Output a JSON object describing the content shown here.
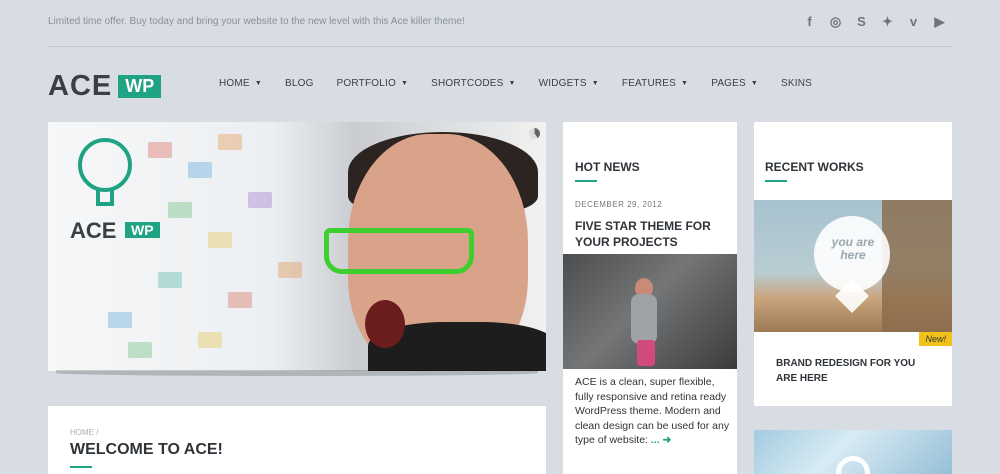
{
  "topbar": {
    "offer": "Limited time offer. Buy today and bring your website to the new level with this Ace killer theme!",
    "social": [
      {
        "icon": "facebook-icon",
        "glyph": "f"
      },
      {
        "icon": "dribbble-icon",
        "glyph": "◎"
      },
      {
        "icon": "skype-icon",
        "glyph": "S"
      },
      {
        "icon": "twitter-icon",
        "glyph": "✦"
      },
      {
        "icon": "vimeo-icon",
        "glyph": "v"
      },
      {
        "icon": "youtube-icon",
        "glyph": "▶"
      }
    ]
  },
  "logo": {
    "ace": "ACE",
    "wp": "WP"
  },
  "nav": {
    "items": [
      {
        "label": "HOME",
        "dropdown": true
      },
      {
        "label": "BLOG",
        "dropdown": false
      },
      {
        "label": "PORTFOLIO",
        "dropdown": true
      },
      {
        "label": "SHORTCODES",
        "dropdown": true
      },
      {
        "label": "WIDGETS",
        "dropdown": true
      },
      {
        "label": "FEATURES",
        "dropdown": true
      },
      {
        "label": "PAGES",
        "dropdown": true
      },
      {
        "label": "SKINS",
        "dropdown": false
      }
    ]
  },
  "hero": {
    "logo_ace": "ACE",
    "logo_wp": "WP"
  },
  "welcome": {
    "breadcrumb": "HOME /",
    "title": "WELCOME TO ACE!"
  },
  "news": {
    "title": "HOT NEWS",
    "date": "DECEMBER 29, 2012",
    "headline": "FIVE STAR THEME FOR YOUR PROJECTS",
    "excerpt": "ACE is a clean, super flexible, fully responsive and retina ready WordPress theme. Modern and clean design can be used for any type of website:",
    "more": "... ➜"
  },
  "works": {
    "title": "RECENT WORKS",
    "pin_text": "you are here",
    "badge": "New!",
    "item_title": "BRAND REDESIGN FOR YOU ARE HERE"
  },
  "colors": {
    "accent": "#1fa384",
    "badge": "#f2c21b",
    "background": "#d7dde3"
  }
}
